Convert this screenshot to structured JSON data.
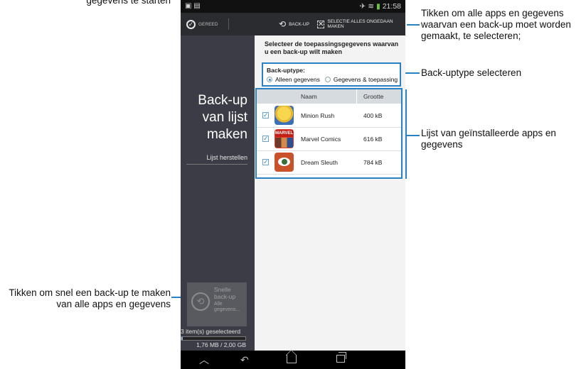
{
  "annotations": {
    "top_left": "gegevens te starten",
    "top_right": "Tikken om alle apps en gegevens waarvan een back-up moet worden gemaakt, te selecteren;",
    "backup_type": "Back-uptype selecteren",
    "installed_list": "Lijst van geïnstalleerde apps en gegevens",
    "quick_backup": "Tikken om snel een back-up te maken van alle apps en gegevens"
  },
  "status_bar": {
    "time": "21:58"
  },
  "action_bar": {
    "done_label": "GEREED",
    "backup_label": "BACK-UP",
    "deselect_label": "SELECTIE ALLES ONGEDAAN MAKEN"
  },
  "sidebar": {
    "title_line1": "Back-up",
    "title_line2": "van lijst",
    "title_line3": "maken",
    "restore_label": "Lijst herstellen",
    "quick_title1": "Snelle",
    "quick_title2": "back-up",
    "quick_sub": "Alle gegevens...",
    "selected_count": "3 item(s) geselecteerd",
    "storage": "1,76 MB / 2,00 GB",
    "storage_fraction": 0.001
  },
  "content": {
    "heading": "Selecteer de toepassingsgegevens waarvan u een back-up wilt maken",
    "type_label": "Back-uptype:",
    "option_data_only": "Alleen gegevens",
    "option_data_app": "Gegevens & toepassing",
    "selected_option": "Alleen gegevens",
    "columns": {
      "name": "Naam",
      "size": "Grootte"
    },
    "apps": [
      {
        "name": "Minion Rush",
        "size": "400 kB",
        "icon": "minion-rush-icon",
        "checked": true
      },
      {
        "name": "Marvel Comics",
        "size": "616 kB",
        "icon": "marvel-comics-icon",
        "checked": true
      },
      {
        "name": "Dream Sleuth",
        "size": "784 kB",
        "icon": "dream-sleuth-icon",
        "checked": true
      }
    ],
    "marvel_logo_text": "MARVEL"
  },
  "colors": {
    "accent": "#2a82c4",
    "sidebar": "#3b3c45",
    "action_bar": "#2b2c30"
  }
}
